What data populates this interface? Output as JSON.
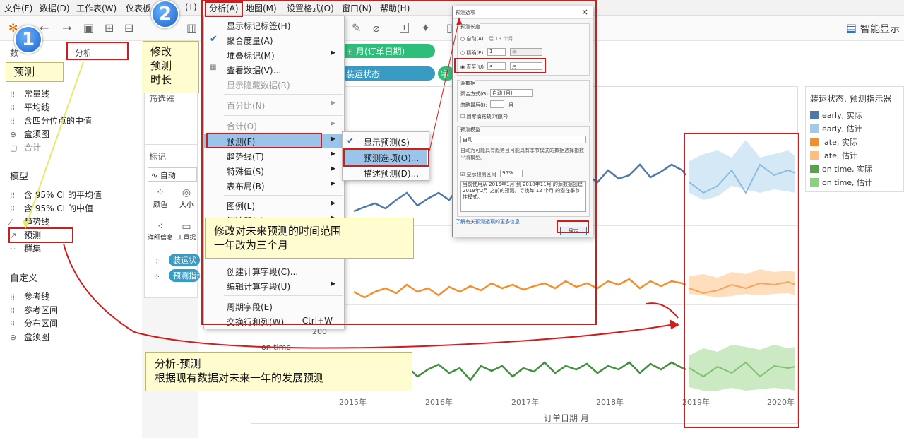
{
  "menubar": {
    "items": [
      "文件(F)",
      "数据(D)",
      "工作表(W)",
      "仪表板",
      "(T)",
      "分析(A)",
      "地图(M)",
      "设置格式(O)",
      "窗口(N)",
      "帮助(H)"
    ]
  },
  "toolbar": {
    "smart_show": "智能显示"
  },
  "left_pane": {
    "tab_data": "数",
    "tab_analytics": "分析",
    "sections": {
      "summary_items": [
        "常量线",
        "平均线",
        "含四分位点的中值",
        "盒须图",
        "合计"
      ],
      "model_title": "模型",
      "model_items": [
        "含 95% CI 的平均值",
        "含 95% CI 的中值",
        "趋势线",
        "预测",
        "群集"
      ],
      "custom_title": "自定义",
      "custom_items": [
        "参考线",
        "参考区间",
        "分布区间",
        "盒须图"
      ]
    }
  },
  "middle_pane": {
    "filters": "筛选器",
    "marks": "标记",
    "mark_type": "自动",
    "color": "颜色",
    "size": "大小",
    "detail": "详细信息",
    "tooltip": "工具提",
    "pill_ship": "装运状",
    "pill_fc": "预测指示"
  },
  "shelves": {
    "columns_pill": "月(订单日期)",
    "rows_pill": "装运状态",
    "rows_pill2": "字"
  },
  "view": {
    "y_label_200": "200",
    "row_label": "on time",
    "x_ticks": [
      "2015年",
      "2016年",
      "2017年",
      "2018年",
      "2019年",
      "2020年"
    ],
    "x_title": "订单日期 月"
  },
  "legend": {
    "title": "装运状态, 预测指示器",
    "items": [
      {
        "label": "early, 实际",
        "color": "#4e79a7"
      },
      {
        "label": "early, 估计",
        "color": "#a0cbe8"
      },
      {
        "label": "late, 实际",
        "color": "#f28e2b"
      },
      {
        "label": "late, 估计",
        "color": "#ffbe7d"
      },
      {
        "label": "on time, 实际",
        "color": "#59a14f"
      },
      {
        "label": "on time, 估计",
        "color": "#8cd17d"
      }
    ]
  },
  "analysis_menu": {
    "items": [
      {
        "label": "显示标记标签(H)",
        "disabled": false
      },
      {
        "label": "聚合度量(A)",
        "checked": true
      },
      {
        "label": "堆叠标记(M)",
        "arrow": true
      },
      {
        "label": "查看数据(V)..."
      },
      {
        "label": "显示隐藏数据(R)",
        "disabled": true
      },
      {
        "label": "百分比(N)",
        "disabled": true,
        "arrow": true
      },
      {
        "label": "合计(O)",
        "disabled": true,
        "arrow": true
      },
      {
        "label": "预测(F)",
        "arrow": true,
        "highlight": true
      },
      {
        "label": "趋势线(T)",
        "arrow": true
      },
      {
        "label": "特殊值(S)",
        "arrow": true
      },
      {
        "label": "表布局(B)",
        "arrow": true
      },
      {
        "label": "图例(L)",
        "arrow": true
      },
      {
        "label": "筛选器(E)",
        "arrow": true
      },
      {
        "label": "创建计算字段(C)..."
      },
      {
        "label": "编辑计算字段(U)",
        "arrow": true
      },
      {
        "label": "周期字段(E)"
      },
      {
        "label": "交换行和列(W)",
        "shortcut": "Ctrl+W"
      }
    ]
  },
  "forecast_submenu": {
    "items": [
      "显示预测(S)",
      "预测选项(O)...",
      "描述预测(D)..."
    ]
  },
  "dialog": {
    "title": "预测选项",
    "close": "×",
    "length_group": "预测长度",
    "auto": "自动(A)",
    "auto_note": "后 13 个月",
    "exact": "精确(E)",
    "exact_val": "1",
    "exact_unit": "年",
    "until": "直至(U)",
    "until_val": "3",
    "until_unit": "月",
    "source_group": "源数据",
    "agg_label": "聚合方式(G):",
    "agg_val": "自动 (月)",
    "ignore_label": "忽略最后(I):",
    "ignore_val": "1",
    "ignore_unit": "月",
    "fill_zero": "用零填充缺少值(F)",
    "model_group": "预测模型",
    "model_val": "自动",
    "model_desc": "自动为可能具有趋势且可能具有季节模式的数据选择指数平滑模型。",
    "show_pi": "显示预测区间",
    "pi_val": "95%",
    "summary": "当前使用从 2015年1月 到 2018年11月 的源数据创建 2019年2月 之前的预测。寻找每 12 个月 的潜在季节性模式。",
    "more_link": "了解有关预测选项的更多信息",
    "ok": "确定"
  },
  "callouts": {
    "c1": "预测",
    "c2": "修改\n预测\n时长",
    "c3": "修改对未来预测的时间范围\n一年改为三个月",
    "c4": "分析-预测\n根据现有数据对未来一年的发展预测",
    "badge1": "1",
    "badge2": "2"
  }
}
